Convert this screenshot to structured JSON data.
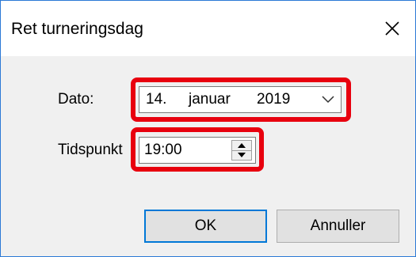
{
  "dialog": {
    "title": "Ret turneringsdag",
    "close_icon": "close-icon"
  },
  "form": {
    "date_label": "Dato:",
    "date_day": "14.",
    "date_month": "januar",
    "date_year": "2019",
    "time_label": "Tidspunkt",
    "time_value": "19:00"
  },
  "buttons": {
    "ok_label": "OK",
    "cancel_label": "Annuller"
  },
  "colors": {
    "highlight": "#e8000e",
    "accent": "#0078d7"
  }
}
